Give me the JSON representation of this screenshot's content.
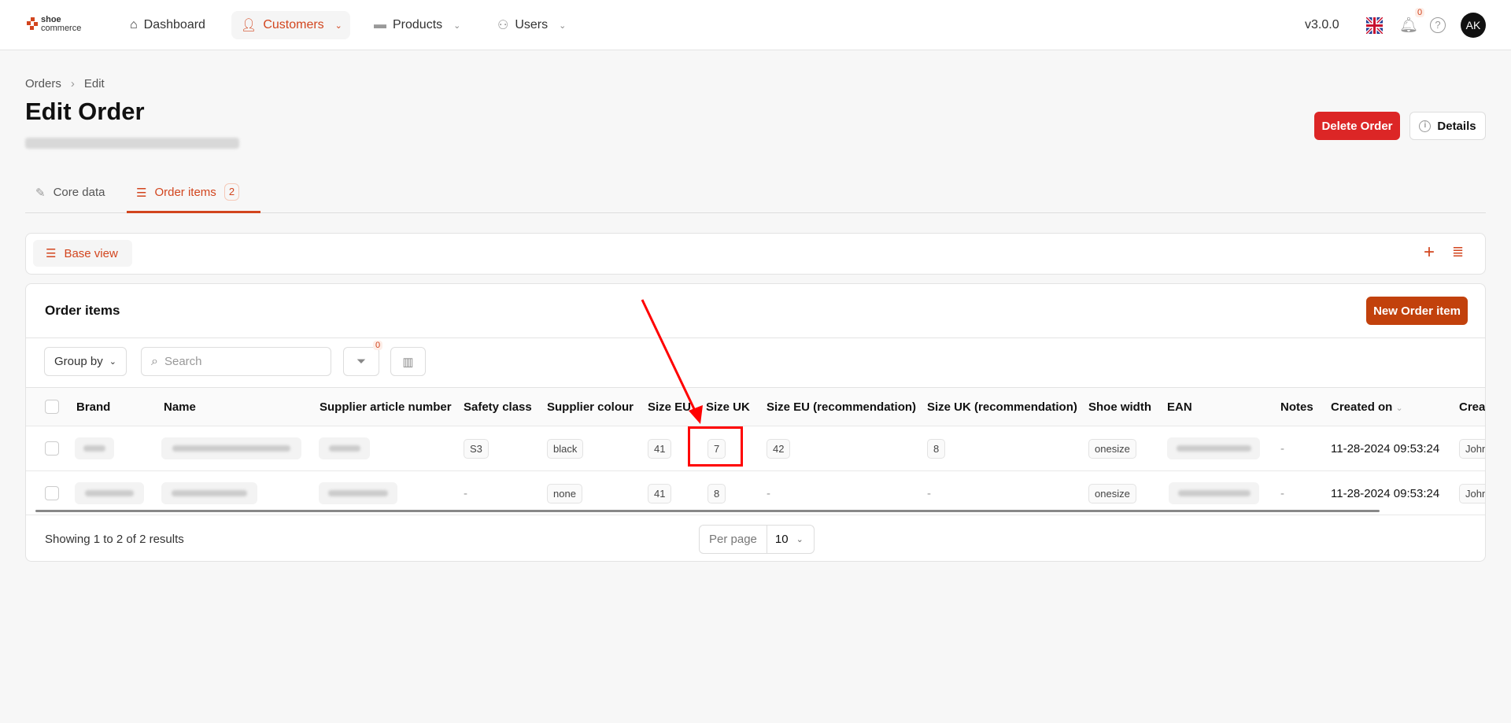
{
  "header": {
    "logo_top": "shoe",
    "logo_bottom": "commerce",
    "nav": [
      {
        "label": "Dashboard",
        "icon": "home-icon"
      },
      {
        "label": "Customers",
        "icon": "user-icon"
      },
      {
        "label": "Products",
        "icon": "shoe-icon"
      },
      {
        "label": "Users",
        "icon": "users-icon"
      }
    ],
    "version": "v3.0.0",
    "notification_count": "0",
    "avatar": "AK"
  },
  "breadcrumb": [
    "Orders",
    "Edit"
  ],
  "page": {
    "title": "Edit Order",
    "delete_label": "Delete Order",
    "details_label": "Details"
  },
  "tabs": [
    {
      "label": "Core data"
    },
    {
      "label": "Order items",
      "count": "2"
    }
  ],
  "view": {
    "label": "Base view"
  },
  "table_card": {
    "title": "Order items",
    "new_label": "New Order item",
    "group_by": "Group by",
    "search_placeholder": "Search",
    "filter_count": "0"
  },
  "columns": [
    "Brand",
    "Name",
    "Supplier article number",
    "Safety class",
    "Supplier colour",
    "Size EU",
    "Size UK",
    "Size EU (recommendation)",
    "Size UK (recommendation)",
    "Shoe width",
    "EAN",
    "Notes",
    "Created on",
    "Creat"
  ],
  "rows": [
    {
      "safety": "S3",
      "colour": "black",
      "size_eu": "41",
      "size_uk": "7",
      "size_eu_rec": "42",
      "size_uk_rec": "8",
      "width": "onesize",
      "notes": "-",
      "created": "11-28-2024 09:53:24",
      "creator": "John"
    },
    {
      "safety": "-",
      "colour": "none",
      "size_eu": "41",
      "size_uk": "8",
      "size_eu_rec": "-",
      "size_uk_rec": "-",
      "width": "onesize",
      "notes": "-",
      "created": "11-28-2024 09:53:24",
      "creator": "John"
    }
  ],
  "footer": {
    "showing": "Showing 1 to 2 of 2 results",
    "per_page_label": "Per page",
    "per_page_value": "10"
  },
  "colors": {
    "accent": "#d2451e",
    "danger": "#dc2626",
    "annotation": "#ff0000"
  }
}
